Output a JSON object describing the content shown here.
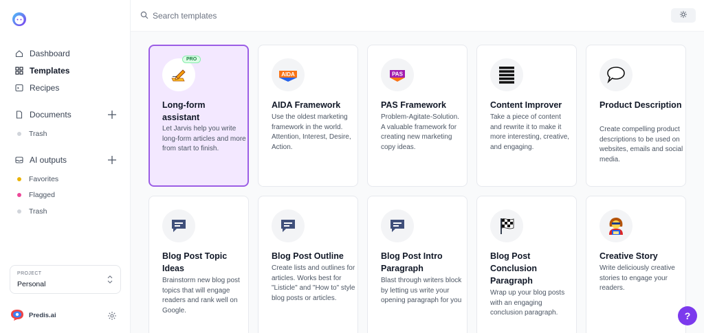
{
  "sidebar": {
    "nav": [
      {
        "label": "Dashboard",
        "icon": "home-icon"
      },
      {
        "label": "Templates",
        "icon": "grid-icon"
      },
      {
        "label": "Recipes",
        "icon": "terminal-icon"
      }
    ],
    "documents": {
      "label": "Documents",
      "trash": "Trash"
    },
    "ai_outputs": {
      "label": "AI outputs",
      "items": [
        "Favorites",
        "Flagged",
        "Trash"
      ]
    },
    "project": {
      "label": "PROJECT",
      "value": "Personal"
    },
    "brand": "Predis.ai"
  },
  "search": {
    "placeholder": "Search templates"
  },
  "colors": {
    "accent": "#7c3aed",
    "selected_bg": "#f3e8ff",
    "favorites": "#eab308",
    "flagged": "#ec4899",
    "trash": "#d1d5db"
  },
  "cards": [
    {
      "title": "Long-form assistant",
      "desc": "Let Jarvis help you write long-form articles and more from start to finish.",
      "icon": "pen-writing-icon",
      "badge": "PRO"
    },
    {
      "title": "AIDA Framework",
      "desc": "Use the oldest marketing framework in the world. Attention, Interest, Desire, Action.",
      "icon": "aida-icon",
      "icon_text": "AIDA"
    },
    {
      "title": "PAS Framework",
      "desc": "Problem-Agitate-Solution. A valuable framework for creating new marketing copy ideas.",
      "icon": "pas-icon",
      "icon_text": "PAS"
    },
    {
      "title": "Content Improver",
      "desc": "Take a piece of content and rewrite it to make it more interesting, creative, and engaging.",
      "icon": "lines-icon"
    },
    {
      "title": "Product Description",
      "desc": "Create compelling product descriptions to be used on websites, emails and social media.",
      "icon": "speech-bubble-icon"
    },
    {
      "title": "Blog Post Topic Ideas",
      "desc": "Brainstorm new blog post topics that will engage readers and rank well on Google.",
      "icon": "message-icon"
    },
    {
      "title": "Blog Post Outline",
      "desc": "Create lists and outlines for articles. Works best for \"Listicle\" and \"How to\" style blog posts or articles.",
      "icon": "message-icon"
    },
    {
      "title": "Blog Post Intro Paragraph",
      "desc": "Blast through writers block by letting us write your opening paragraph for you",
      "icon": "message-icon"
    },
    {
      "title": "Blog Post Conclusion Paragraph",
      "desc": "Wrap up your blog posts with an engaging conclusion paragraph.",
      "icon": "checkered-flag-icon"
    },
    {
      "title": "Creative Story",
      "desc": "Write deliciously creative stories to engage your readers.",
      "icon": "storyteller-icon"
    }
  ],
  "help": {
    "label": "?"
  }
}
